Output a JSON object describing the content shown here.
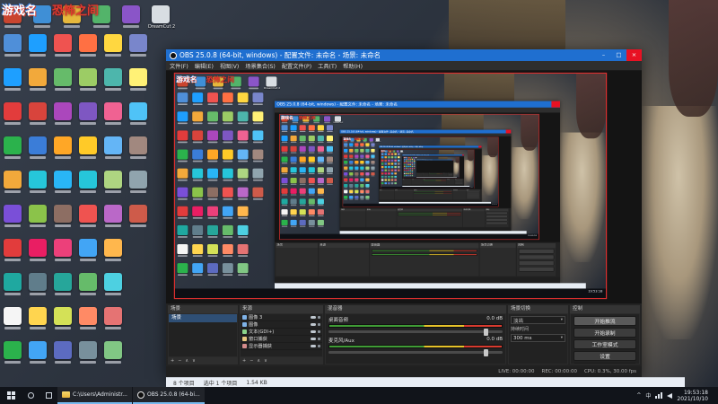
{
  "overlay": {
    "game_label": "游戏名",
    "room_label": "恐怖之间"
  },
  "desktop": {
    "top_icons": [
      {
        "color": "#c9452f",
        "label": ""
      },
      {
        "color": "#3f8fd6",
        "label": ""
      },
      {
        "color": "#e6b83c",
        "label": ""
      },
      {
        "color": "#53b46a",
        "label": ""
      },
      {
        "color": "#8a55c8",
        "label": ""
      },
      {
        "color": "#d8dde2",
        "label": "DreamCut 2"
      }
    ],
    "icon_colors": [
      "#4f8fd9",
      "#1e9fff",
      "#e23c3c",
      "#2bb24c",
      "#f2a93b",
      "#7a4fd8",
      "#e23c3c",
      "#1fa8a0",
      "#f5f5f5",
      "#2bb24c",
      "#1e9fff",
      "#f2a93b",
      "#d8443c",
      "#3b7dd8",
      "#26c6da",
      "#8bc34a",
      "#e91e63",
      "#607d8b",
      "#ffd54f",
      "#42a5f5",
      "#ef5350",
      "#66bb6a",
      "#ab47bc",
      "#ffa726",
      "#29b6f6",
      "#8d6e63",
      "#ec407a",
      "#26a69a",
      "#d4e157",
      "#5c6bc0",
      "#ff7043",
      "#9ccc65",
      "#7e57c2",
      "#ffca28",
      "#26c6da",
      "#ef5350",
      "#42a5f5",
      "#66bb6a",
      "#ff8a65",
      "#78909c",
      "#ffd740",
      "#4db6ac",
      "#f06292",
      "#64b5f6",
      "#aed581",
      "#ba68c8",
      "#ffb74d",
      "#4dd0e1",
      "#e57373",
      "#81c784",
      "#7986cb",
      "#fff176",
      "#4fc3f7",
      "#a1887f",
      "#90a4ae",
      "#ce5b4a"
    ]
  },
  "obs": {
    "title": "OBS 25.0.8 (64-bit, windows) - 配置文件: 未命名 - 场景: 未命名",
    "menu": [
      "文件(F)",
      "编辑(E)",
      "视图(V)",
      "场景集合(S)",
      "配置文件(P)",
      "工具(T)",
      "帮助(H)"
    ],
    "scenes": {
      "title": "场景",
      "items": [
        "场景"
      ]
    },
    "sources": {
      "title": "来源",
      "items": [
        "图像 3",
        "图像",
        "文本(GDI+)",
        "窗口捕获",
        "显示器捕获"
      ]
    },
    "mixer": {
      "title": "混音器",
      "channels": [
        {
          "name": "桌面音频",
          "db": "0.0 dB"
        },
        {
          "name": "麦克风/Aux",
          "db": "0.0 dB"
        }
      ]
    },
    "transitions": {
      "title": "场景切换",
      "transition": "淡出",
      "duration_label": "持续时间",
      "duration": "300 ms"
    },
    "controls": {
      "title": "控制",
      "buttons": [
        "开始推流",
        "开始录制",
        "工作室模式",
        "设置",
        "退出"
      ]
    },
    "status": {
      "live": "LIVE: 00:00:00",
      "rec": "REC: 00:00:00",
      "cpu": "CPU: 0.3%, 30.00 fps"
    }
  },
  "explorer": {
    "items_count": "8 个项目",
    "selected": "选中 1 个项目",
    "size": "1.54 KB"
  },
  "taskbar": {
    "explorer_button": "C:\\Users\\Administr...",
    "obs_button": "OBS 25.0.8 (64-bi...",
    "ime": "中",
    "time": "19:53:18",
    "date": "2021/10/10"
  },
  "colors": {
    "titlebar": "#1f6fd0",
    "close_button": "#e81123",
    "selection_outline": "#f03232"
  }
}
